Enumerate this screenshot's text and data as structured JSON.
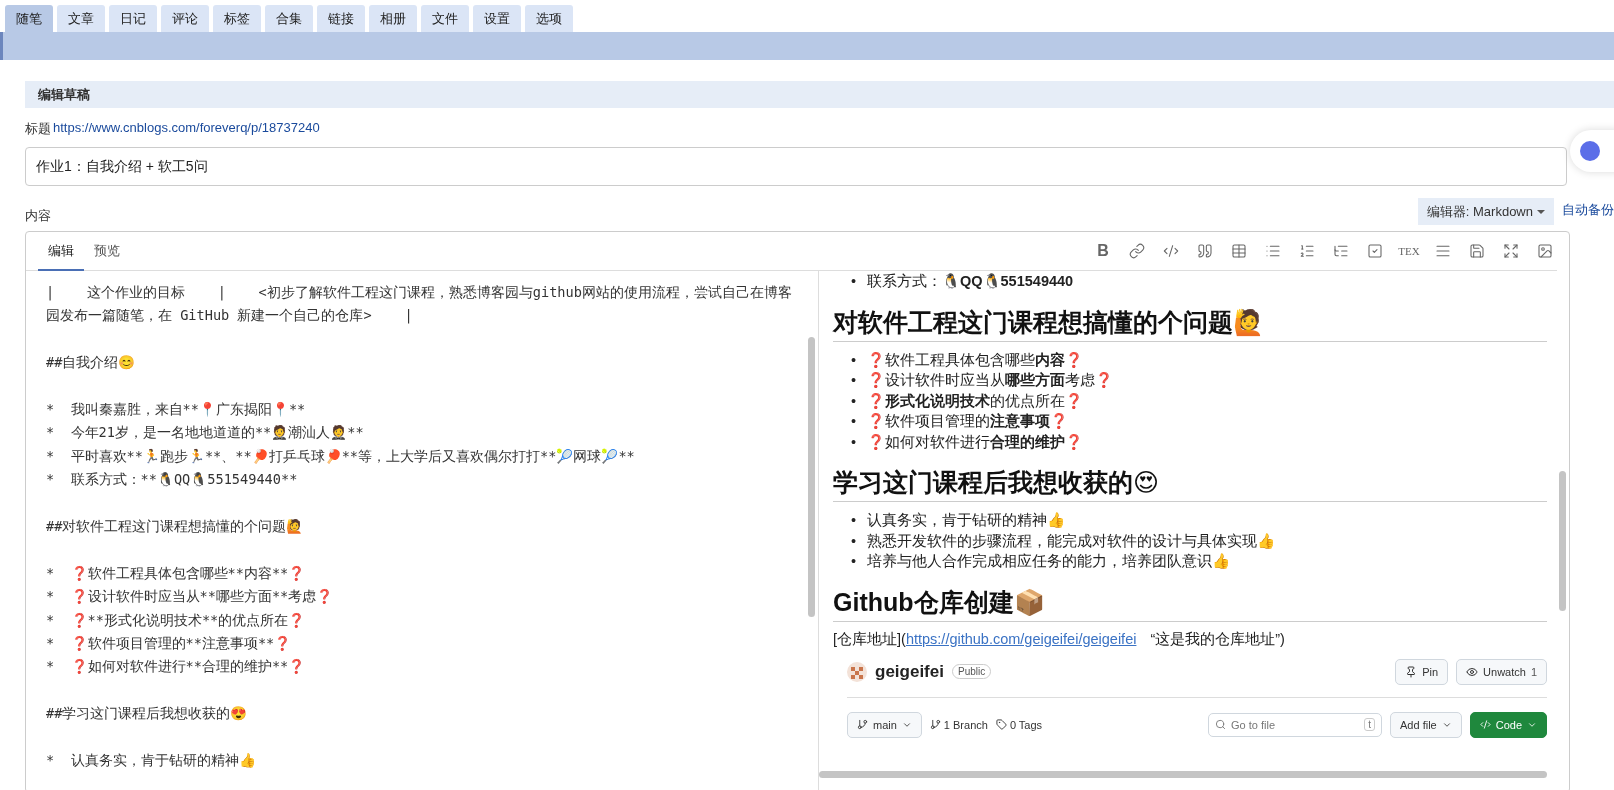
{
  "nav_tabs": [
    {
      "label": "随笔",
      "selected": true
    },
    {
      "label": "文章",
      "selected": false
    },
    {
      "label": "日记",
      "selected": false
    },
    {
      "label": "评论",
      "selected": false
    },
    {
      "label": "标签",
      "selected": false
    },
    {
      "label": "合集",
      "selected": false
    },
    {
      "label": "链接",
      "selected": false
    },
    {
      "label": "相册",
      "selected": false
    },
    {
      "label": "文件",
      "selected": false
    },
    {
      "label": "设置",
      "selected": false
    },
    {
      "label": "选项",
      "selected": false
    }
  ],
  "section_title": "编辑草稿",
  "title_field": {
    "label": "标题",
    "link": "https://www.cnblogs.com/foreverq/p/18737240",
    "value": "作业1：自我介绍 + 软工5问"
  },
  "content_label": "内容",
  "editor_select": "编辑器: Markdown",
  "autosave_link": "自动备份",
  "editor": {
    "tabs": [
      {
        "label": "编辑",
        "selected": true
      },
      {
        "label": "预览",
        "selected": false
      }
    ],
    "toolbar": [
      {
        "kind": "text",
        "label": "B"
      },
      {
        "kind": "link"
      },
      {
        "kind": "code"
      },
      {
        "kind": "quote"
      },
      {
        "kind": "table"
      },
      {
        "kind": "bullets"
      },
      {
        "kind": "numbers"
      },
      {
        "kind": "tree"
      },
      {
        "kind": "checkbox"
      },
      {
        "kind": "tex",
        "label": "TEX"
      },
      {
        "kind": "lines"
      },
      {
        "kind": "save"
      },
      {
        "kind": "expand"
      },
      {
        "kind": "image"
      }
    ],
    "source_blocks": [
      [
        "|    这个作业的目标    |    <初步了解软件工程这门课程，熟悉博客园与github网站的使用流程，尝试自己在博客园发布一篇随笔，在 GitHub 新建一个自己的仓库>    |"
      ],
      [
        "##自我介绍😊"
      ],
      [
        "*  我叫秦嘉胜，来自**📍广东揭阳📍**",
        "*  今年21岁，是一名地地道道的**🤵潮汕人🤵**",
        "*  平时喜欢**🏃跑步🏃**、**🏓打乒乓球🏓**等，上大学后又喜欢偶尔打打**🎾网球🎾**",
        "*  联系方式：**🐧QQ🐧551549440**"
      ],
      [
        "##对软件工程这门课程想搞懂的个问题🙋"
      ],
      [
        "*  ❓软件工程具体包含哪些**内容**❓",
        "*  ❓设计软件时应当从**哪些方面**考虑❓",
        "*  ❓**形式化说明技术**的优点所在❓",
        "*  ❓软件项目管理的**注意事项**❓",
        "*  ❓如何对软件进行**合理的维护**❓"
      ],
      [
        "##学习这门课程后我想收获的😍"
      ],
      [
        "*  认真务实，肯于钻研的精神👍"
      ]
    ],
    "preview": [
      {
        "kind": "list",
        "marker": "•",
        "items": [
          "联系方式：🐧**QQ🐧551549440**"
        ]
      },
      {
        "kind": "heading",
        "text": "对软件工程这门课程想搞懂的个问题🙋"
      },
      {
        "kind": "list",
        "marker": "•",
        "items": [
          "❓软件工程具体包含哪些**内容**❓",
          "❓设计软件时应当从**哪些方面**考虑❓",
          "❓**形式化说明技术**的优点所在❓",
          "❓软件项目管理的**注意事项**❓",
          "❓如何对软件进行**合理的维护**❓"
        ]
      },
      {
        "kind": "heading",
        "text": "学习这门课程后我想收获的😍"
      },
      {
        "kind": "list",
        "marker": "•",
        "items": [
          "认真务实，肯于钻研的精神👍",
          "熟悉开发软件的步骤流程，能完成对软件的设计与具体实现👍",
          "培养与他人合作完成相应任务的能力，培养团队意识👍"
        ]
      },
      {
        "kind": "heading",
        "text": "Github仓库创建📦"
      },
      {
        "kind": "paragraph",
        "before": "[仓库地址](",
        "link": "https://github.com/geigeifei/geigeifei",
        "after": "“这是我的仓库地址”)"
      },
      {
        "kind": "repo_card",
        "name": "geigeifei",
        "visibility": "Public",
        "pin": "Pin",
        "watch": "Unwatch",
        "watch_count": "1",
        "branch": "main",
        "branches": "1 Branch",
        "tags": "0 Tags",
        "search_placeholder": "Go to file",
        "search_key": "t",
        "add_file": "Add file",
        "code": "Code"
      }
    ]
  }
}
